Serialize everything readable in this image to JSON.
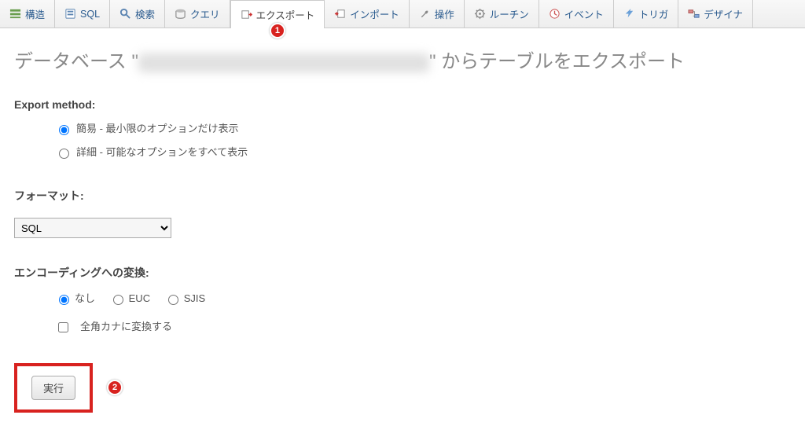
{
  "nav": {
    "tabs": [
      {
        "id": "structure",
        "label": "構造"
      },
      {
        "id": "sql",
        "label": "SQL"
      },
      {
        "id": "search",
        "label": "検索"
      },
      {
        "id": "query",
        "label": "クエリ"
      },
      {
        "id": "export",
        "label": "エクスポート",
        "active": true,
        "badge": "1"
      },
      {
        "id": "import",
        "label": "インポート"
      },
      {
        "id": "operations",
        "label": "操作"
      },
      {
        "id": "routines",
        "label": "ルーチン"
      },
      {
        "id": "events",
        "label": "イベント"
      },
      {
        "id": "triggers",
        "label": "トリガ"
      },
      {
        "id": "designer",
        "label": "デザイナ"
      }
    ]
  },
  "title": {
    "prefix": "データベース \"",
    "suffix": "\" からテーブルをエクスポート"
  },
  "export_method": {
    "heading": "Export method:",
    "quick": "簡易 - 最小限のオプションだけ表示",
    "custom": "詳細 - 可能なオプションをすべて表示",
    "selected": "quick"
  },
  "format": {
    "heading": "フォーマット:",
    "selected": "SQL",
    "options": [
      "SQL"
    ]
  },
  "encoding": {
    "heading": "エンコーディングへの変換:",
    "none": "なし",
    "euc": "EUC",
    "sjis": "SJIS",
    "selected": "none",
    "fullwidth_kana": "全角カナに変換する",
    "fullwidth_checked": false
  },
  "submit": {
    "label": "実行",
    "badge": "2"
  }
}
